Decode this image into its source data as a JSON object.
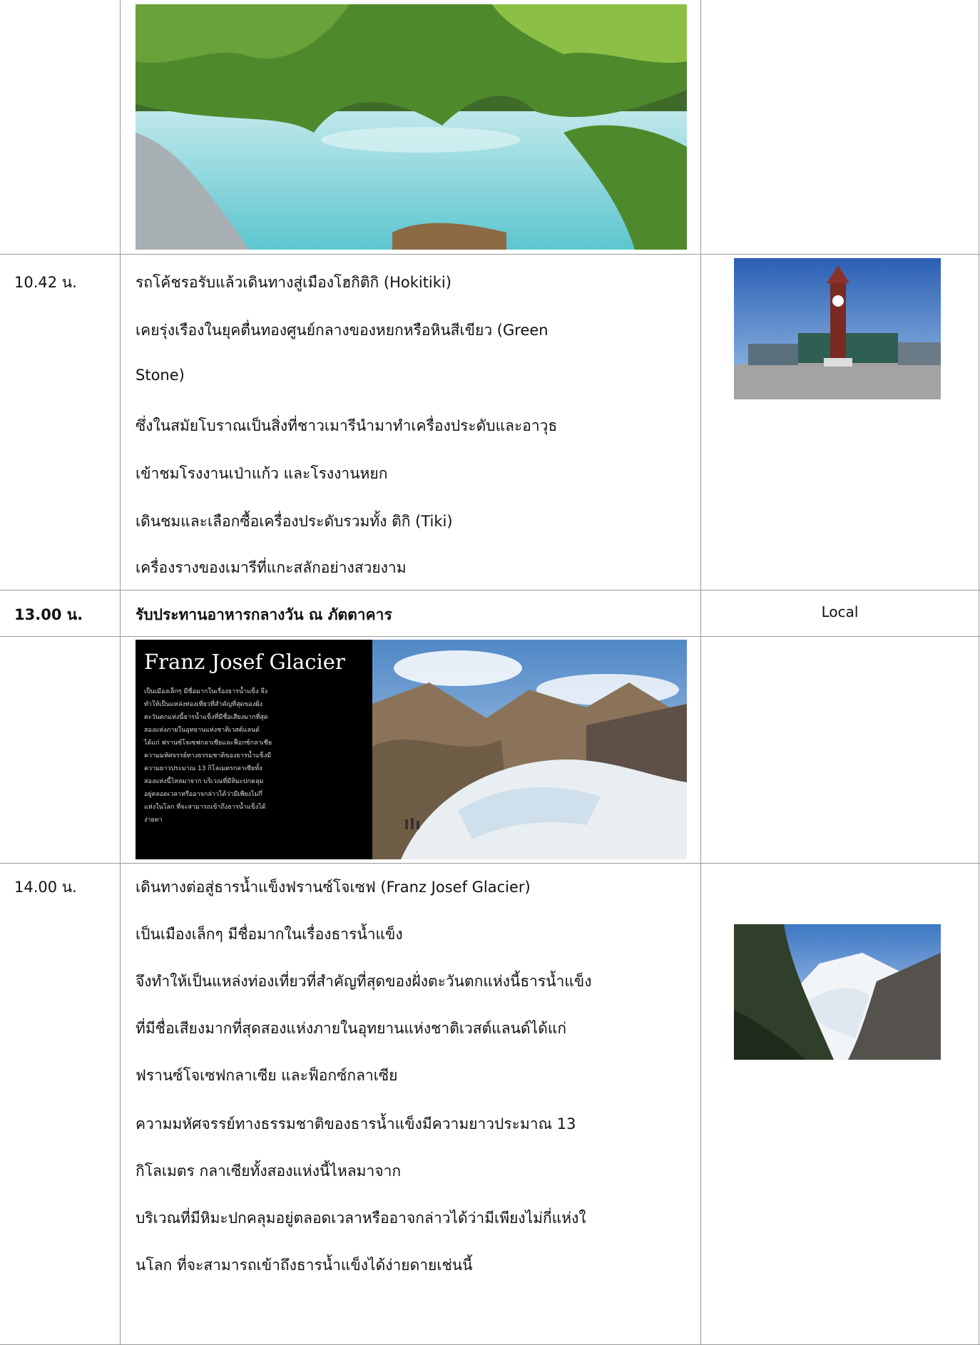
{
  "rows": [
    {
      "time": "10.42 น.",
      "lines": [
        "รถโค้ชรอรับแล้วเดินทางสู่เมืองโฮกิติกิ (Hokitiki)",
        "เคยรุ่งเรืองในยุคตื่นทองศูนย์กลางของหยกหรือหินสีเขียว (Green",
        "Stone)",
        "ซึ่งในสมัยโบราณเป็นสิ่งที่ชาวเมารีนำมาทำเครื่องประดับและอาวุธ",
        "เข้าชมโรงงานเป่าแก้ว และโรงงานหยก",
        "เดินชมและเลือกซื้อเครื่องประดับรวมทั้ง ติกิ (Tiki)",
        "เครื่องรางของเมารีที่แกะสลักอย่างสวยงาม"
      ]
    },
    {
      "time": "13.00 น.",
      "text": "รับประทานอาหารกลางวัน ณ ภัตตาคาร",
      "note": "Local"
    },
    {
      "banner_title": "Franz Josef Glacier",
      "banner_text": [
        "เป็นเมืองเล็กๆ มีชื่อมากในเรื่องธารน้ำแข็ง จึง",
        "ทำให้เป็นแหล่งท่องเที่ยวที่สำคัญที่สุดของฝั่ง",
        "ตะวันตกแห่งนี้ธารน้ำแข็งที่มีชื่อเสียงมากที่สุด",
        "สองแห่งภายในอุทยานแห่งชาติเวสต์แลนด์",
        "ได้แก่ ฟรานซ์โจเซฟกลาเซียและฟ็อกซ์กลาเซีย",
        "ความมหัศจรรย์ทางธรรมชาติของธารน้ำแข็งมี",
        "ความยาวประมาณ 13 กิโลเมตรกลาเซียทั้ง",
        "สองแห่งนี้ไหลมาจาก บริเวณที่มีหิมะปกคลุม",
        "อยู่ตลอดเวลาหรืออาจกล่าวได้ว่ามีเพียงไม่กี่",
        "แห่งในโลก ที่จะสามารถเข้าถึงธารน้ำแข็งได้",
        "ง่ายดา"
      ]
    },
    {
      "time": "14.00 น.",
      "lines": [
        "เดินทางต่อสู่ธารน้ำแข็งฟรานซ์โจเซฟ (Franz Josef Glacier)",
        "เป็นเมืองเล็กๆ มีชื่อมากในเรื่องธารน้ำแข็ง",
        "จึงทำให้เป็นแหล่งท่องเที่ยวที่สำคัญที่สุดของฝั่งตะวันตกแห่งนี้ธารน้ำแข็ง",
        "ที่มีชื่อเสียงมากที่สุดสองแห่งภายในอุทยานแห่งชาติเวสต์แลนด์ได้แก่",
        "ฟรานซ์โจเซฟกลาเซีย และฟ็อกซ์กลาเซีย",
        "ความมหัศจรรย์ทางธรรมชาติของธารน้ำแข็งมีความยาวประมาณ 13",
        "กิโลเมตร กลาเซียทั้งสองแห่งนี้ไหลมาจาก",
        "บริเวณที่มีหิมะปกคลุมอยู่ตลอดเวลาหรืออาจกล่าวได้ว่ามีเพียงไม่กี่แห่งใ",
        "นโลก ที่จะสามารถเข้าถึงธารน้ำแข็งได้ง่ายดายเช่นนี้"
      ]
    }
  ]
}
